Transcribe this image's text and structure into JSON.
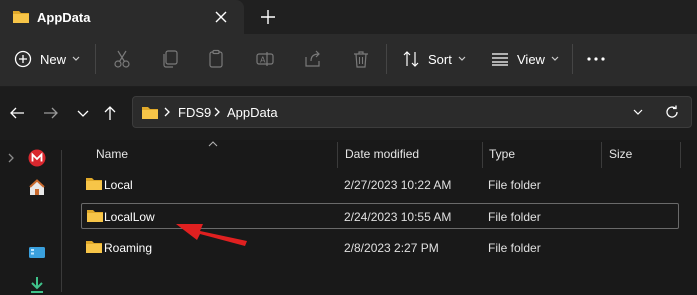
{
  "window": {
    "tab_title": "AppData"
  },
  "toolbar": {
    "new_label": "New",
    "sort_label": "Sort",
    "view_label": "View"
  },
  "address": {
    "crumbs": [
      "FDS9",
      "AppData"
    ]
  },
  "columns": {
    "name": "Name",
    "date": "Date modified",
    "type": "Type",
    "size": "Size"
  },
  "files": [
    {
      "name": "Local",
      "date": "2/27/2023 10:22 AM",
      "type": "File folder",
      "size": ""
    },
    {
      "name": "LocalLow",
      "date": "2/24/2023 10:55 AM",
      "type": "File folder",
      "size": "",
      "selected": true
    },
    {
      "name": "Roaming",
      "date": "2/8/2023 2:27 PM",
      "type": "File folder",
      "size": ""
    }
  ],
  "colors": {
    "folder": "#f7c548",
    "folder_dark": "#e0a92a",
    "annotation_arrow": "#e02020",
    "background": "#191919"
  },
  "icons": [
    "folder-icon",
    "close-icon",
    "plus-icon",
    "new-icon",
    "cut-icon",
    "copy-icon",
    "paste-icon",
    "rename-icon",
    "share-icon",
    "delete-icon",
    "sort-icon",
    "view-icon",
    "more-icon",
    "back-icon",
    "forward-icon",
    "recent-icon",
    "up-icon",
    "refresh-icon",
    "mega-icon",
    "home-icon",
    "desktop-icon",
    "downloads-icon"
  ]
}
